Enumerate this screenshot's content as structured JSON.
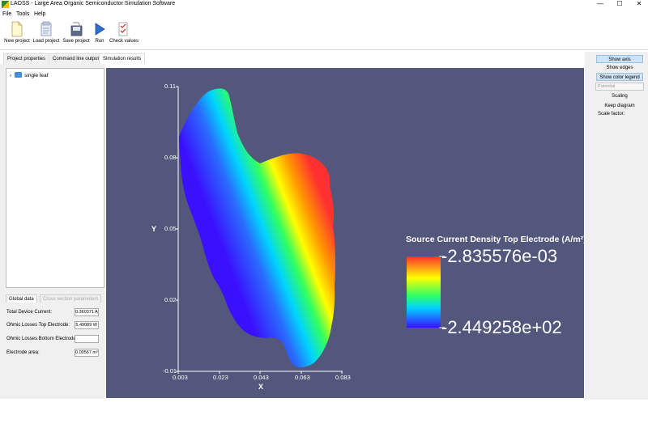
{
  "window": {
    "title": "LAOSS - Large Area Organic Semiconductor Simulation Software",
    "minimize": "—",
    "maximize": "☐",
    "close": "✕"
  },
  "menu": [
    "File",
    "Tools",
    "Help"
  ],
  "toolbar": [
    {
      "label": "New project",
      "icon": "new-file-icon"
    },
    {
      "label": "Load project",
      "icon": "load-project-icon"
    },
    {
      "label": "Save project",
      "icon": "save-project-icon"
    },
    {
      "label": "Run",
      "icon": "run-icon"
    },
    {
      "label": "Check values",
      "icon": "check-values-icon"
    }
  ],
  "tabs": [
    "Project properties",
    "Command line output",
    "Simulation results"
  ],
  "active_tab": "Simulation results",
  "tree": {
    "expand": "›",
    "item": "single leaf"
  },
  "global_data": {
    "tabs": [
      "Global data",
      "Cross section parameters"
    ],
    "rows": [
      {
        "label": "Total Device Current:",
        "value": "0.360371 A"
      },
      {
        "label": "Ohmic Losses Top Electrode:",
        "value": "5.49089 W"
      },
      {
        "label": "Ohmic Losses Bottom Electrode:",
        "value": ""
      },
      {
        "label": "Electrode area:",
        "value": "0.00567 m²"
      }
    ]
  },
  "right_panel": {
    "show_axis": "Show axis",
    "show_edges": "Show edges",
    "show_color_legend": "Show color legend",
    "field_select": "Potential",
    "scaling": "Scaling",
    "keep_diagram": "Keep diagram",
    "scale_factor": "Scale factor:"
  },
  "plot": {
    "legend_title": "Source Current Density Top Electrode (A/m²)",
    "legend_max": "-2.835576e-03",
    "legend_min": "-2.449258e+02",
    "xlabel": "X",
    "ylabel": "Y",
    "xticks": [
      "0.003",
      "0.023",
      "0.043",
      "0.063",
      "0.083"
    ],
    "yticks": [
      "0.11",
      "0.08",
      "0.05",
      "0.02",
      "-0.01"
    ],
    "colors": {
      "background": "#52577b",
      "max": "#ff3030",
      "mid_high": "#ffff00",
      "mid": "#00d4ff",
      "min": "#3a10ff"
    }
  }
}
